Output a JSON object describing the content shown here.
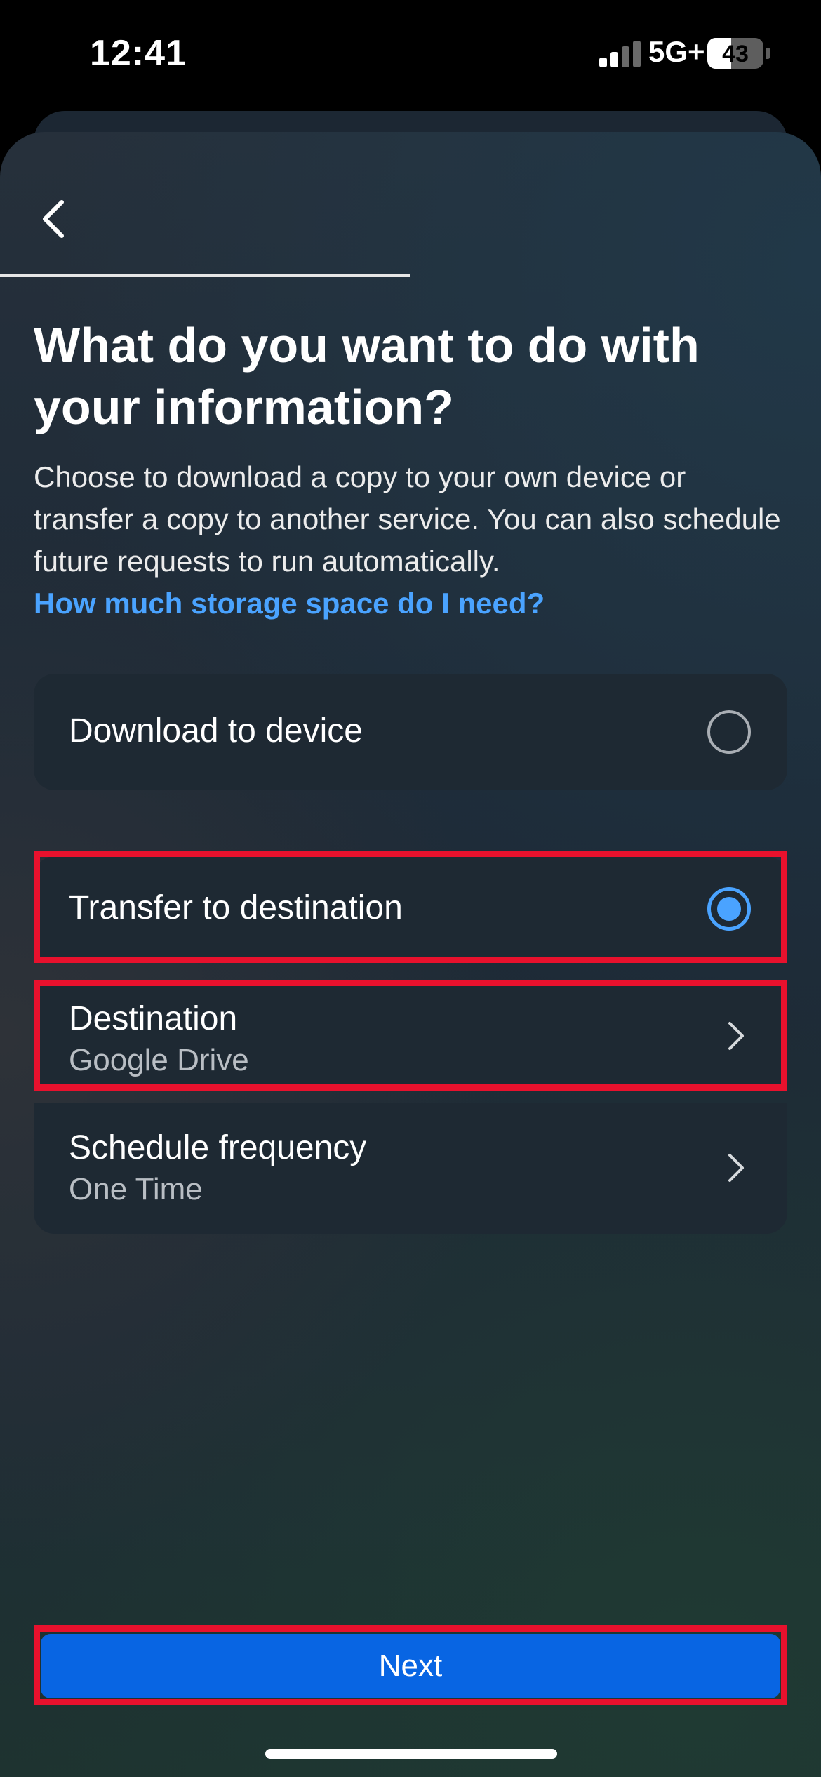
{
  "status_bar": {
    "time": "12:41",
    "network": "5G+",
    "battery": "43",
    "battery_level": 0.43,
    "signal_bars_active": 2,
    "signal_bars_total": 4
  },
  "header": {
    "back_icon": "chevron-left-icon"
  },
  "page": {
    "title": "What do you want to do with your information?",
    "description": "Choose to download a copy to your own device or transfer a copy to another service. You can also schedule future requests to run automatically.",
    "help_link": "How much storage space do I need?"
  },
  "options": {
    "download": {
      "label": "Download to device",
      "selected": false
    },
    "transfer": {
      "label": "Transfer to destination",
      "selected": true
    }
  },
  "transfer_settings": {
    "destination": {
      "label": "Destination",
      "value": "Google Drive",
      "icon": "chevron-right-icon"
    },
    "schedule": {
      "label": "Schedule frequency",
      "value": "One Time",
      "icon": "chevron-right-icon"
    }
  },
  "footer": {
    "next_label": "Next"
  },
  "colors": {
    "accent": "#4aa3ff",
    "button": "#0865e3",
    "highlight": "#e8112d"
  }
}
